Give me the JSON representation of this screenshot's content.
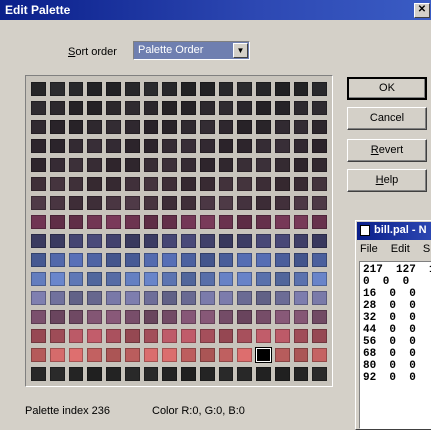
{
  "window": {
    "title": "Edit Palette",
    "close_glyph": "✕"
  },
  "sort": {
    "label": "Sort order",
    "value": "Palette Order"
  },
  "buttons": {
    "ok": "OK",
    "cancel": "Cancel",
    "revert": "Revert",
    "help": "Help"
  },
  "status": {
    "index_text": "Palette index  236",
    "color_text": "Color  R:0, G:0, B:0"
  },
  "palette": {
    "cols": 16,
    "rows": 16,
    "selected_index": 236,
    "row_colors": [
      "#2b2b2e",
      "#2f2b30",
      "#332c33",
      "#382e37",
      "#3c3039",
      "#45343e",
      "#4f3a47",
      "#7a3a5a",
      "#4a4a7a",
      "#5870b8",
      "#6a86cc",
      "#7f7fb0",
      "#8a5a7a",
      "#c45e6c",
      "#e07070",
      "#2a2a2a"
    ]
  },
  "notepad": {
    "title": "bill.pal - N",
    "menu": [
      "File",
      "Edit",
      "S"
    ],
    "lines": [
      "217  127  1",
      "0  0  0",
      "16  0  0",
      "28  0  0",
      "32  0  0",
      "44  0  0",
      "56  0  0",
      "68  0  0",
      "80  0  0",
      "92  0  0"
    ]
  }
}
